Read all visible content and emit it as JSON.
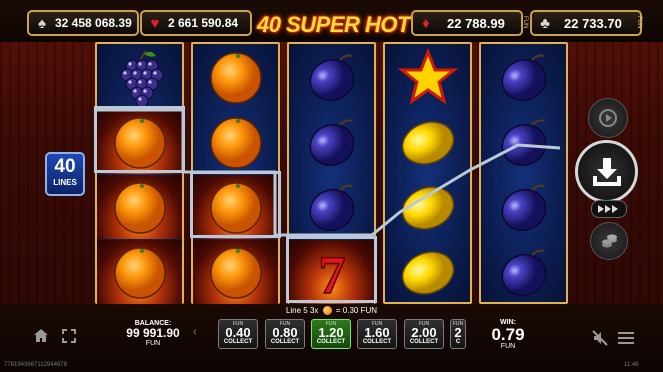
{
  "jackpots": [
    {
      "suit": "spade-icon",
      "glyph": "♠",
      "amount": "32 458 068.39",
      "color": "#cfcfcf"
    },
    {
      "suit": "heart-icon",
      "glyph": "♥",
      "amount": "2 661 590.84",
      "color": "#e0202a"
    },
    {
      "suit": "diamond-icon",
      "glyph": "♦",
      "amount": "22 788.99",
      "color": "#e0202a"
    },
    {
      "suit": "club-icon",
      "glyph": "♣",
      "amount": "22 733.70",
      "color": "#cfcfcf"
    }
  ],
  "title": "40 SUPER HOT",
  "fun_tag": "FUN",
  "lines_badge": {
    "count": "40",
    "label": "LINES"
  },
  "reels": [
    [
      "grapes",
      "orange",
      "orange",
      "orange"
    ],
    [
      "orange",
      "orange",
      "orange",
      "orange"
    ],
    [
      "plum",
      "plum",
      "plum",
      "seven"
    ],
    [
      "star",
      "lemon",
      "lemon",
      "lemon"
    ],
    [
      "plum",
      "plum",
      "plum",
      "plum"
    ]
  ],
  "line_info": {
    "prefix": "Line 5 3x",
    "amount": "= 0.30 FUN"
  },
  "balance": {
    "label": "BALANCE:",
    "value": "99 991.90",
    "currency": "FUN"
  },
  "bets": [
    {
      "fun": "FUN",
      "value": "0.40",
      "collect": "COLLECT",
      "selected": false
    },
    {
      "fun": "FUN",
      "value": "0.80",
      "collect": "COLLECT",
      "selected": false
    },
    {
      "fun": "FUN",
      "value": "1.20",
      "collect": "COLLECT",
      "selected": true
    },
    {
      "fun": "FUN",
      "value": "1.60",
      "collect": "COLLECT",
      "selected": false
    },
    {
      "fun": "FUN",
      "value": "2.00",
      "collect": "COLLECT",
      "selected": false
    },
    {
      "fun": "FUN",
      "value": "2",
      "collect": "C",
      "selected": false
    }
  ],
  "win": {
    "label": "WIN:",
    "value": "0.79",
    "currency": "FUN"
  },
  "footer": {
    "session_id": "7781943667112944678",
    "clock": "11:46"
  },
  "colors": {
    "gold": "#e0b34d",
    "selected_bet": "#2d7a1c",
    "reel_bg": "#0a1a4a"
  }
}
